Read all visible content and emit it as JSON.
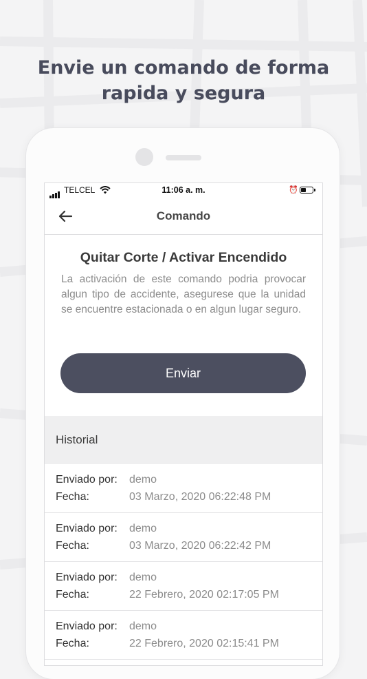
{
  "headline": {
    "line1": "Envie un comando de forma",
    "line2": "rapida y segura"
  },
  "status_bar": {
    "carrier": "TELCEL",
    "time": "11:06 a. m.",
    "battery_level": 0.45
  },
  "nav": {
    "title": "Comando",
    "back_icon": "arrow-left-icon"
  },
  "command": {
    "title": "Quitar Corte / Activar Encendido",
    "description": "La activación de este comando podria provocar algun tipo de accidente, asegurese que la unidad se encuentre estacionada o en algun lugar seguro.",
    "send_label": "Enviar"
  },
  "history": {
    "title": "Historial",
    "sent_by_label": "Enviado por:",
    "date_label": "Fecha:",
    "entries": [
      {
        "user": "demo",
        "date": "03 Marzo, 2020 06:22:48 PM"
      },
      {
        "user": "demo",
        "date": "03 Marzo, 2020 06:22:42 PM"
      },
      {
        "user": "demo",
        "date": "22 Febrero, 2020 02:17:05 PM"
      },
      {
        "user": "demo",
        "date": "22 Febrero, 2020 02:15:41 PM"
      }
    ]
  },
  "colors": {
    "accent": "#4c4f60",
    "headline": "#484b5c",
    "muted_text": "#8c8c8c",
    "section_bg": "#efeff0"
  }
}
